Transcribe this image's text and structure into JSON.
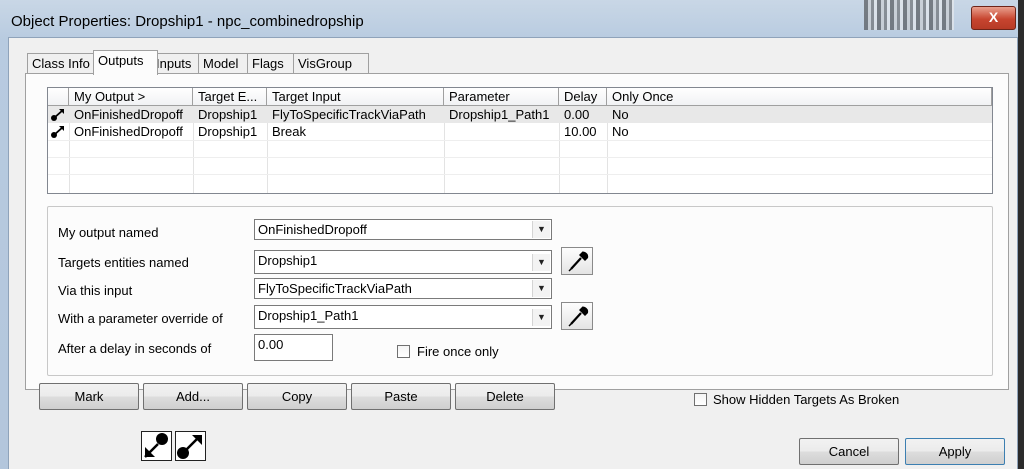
{
  "window": {
    "title": "Object Properties: Dropship1 - npc_combinedropship",
    "close_label": "X"
  },
  "tabs": [
    {
      "label": "Class Info"
    },
    {
      "label": "Outputs",
      "active": true
    },
    {
      "label": "Inputs"
    },
    {
      "label": "Model"
    },
    {
      "label": "Flags"
    },
    {
      "label": "VisGroup"
    }
  ],
  "outputs_table": {
    "columns": [
      "My Output >",
      "Target E...",
      "Target Input",
      "Parameter",
      "Delay",
      "Only Once"
    ],
    "rows": [
      {
        "icon": "output-link-icon",
        "my_output": "OnFinishedDropoff",
        "target_entity": "Dropship1",
        "target_input": "FlyToSpecificTrackViaPath",
        "parameter": "Dropship1_Path1",
        "delay": "0.00",
        "only_once": "No",
        "selected": true
      },
      {
        "icon": "output-link-icon",
        "my_output": "OnFinishedDropoff",
        "target_entity": "Dropship1",
        "target_input": "Break",
        "parameter": "",
        "delay": "10.00",
        "only_once": "No",
        "selected": false
      }
    ]
  },
  "form": {
    "output_label": "My output named",
    "output_value": "OnFinishedDropoff",
    "targets_label": "Targets entities named",
    "targets_value": "Dropship1",
    "input_label": "Via this input",
    "input_value": "FlyToSpecificTrackViaPath",
    "param_label": "With a parameter override of",
    "param_value": "Dropship1_Path1",
    "delay_label": "After a delay in seconds of",
    "delay_value": "0.00",
    "fire_once_label": "Fire once only",
    "fire_once_checked": false
  },
  "buttons": {
    "mark": "Mark",
    "add": "Add...",
    "copy": "Copy",
    "paste": "Paste",
    "delete": "Delete"
  },
  "show_hidden_label": "Show Hidden Targets As Broken",
  "show_hidden_checked": false,
  "footer": {
    "cancel": "Cancel",
    "apply": "Apply"
  }
}
